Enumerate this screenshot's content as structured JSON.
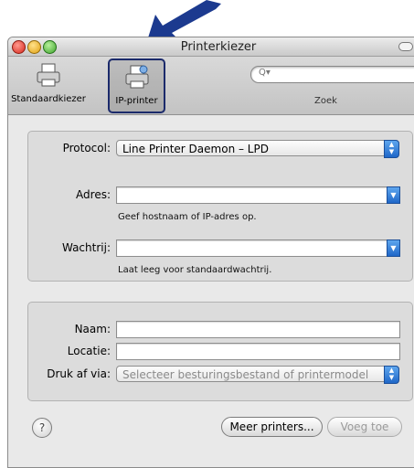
{
  "window": {
    "title": "Printerkiezer"
  },
  "toolbar": {
    "items": [
      {
        "label": "Standaardkiezer"
      },
      {
        "label": "IP-printer"
      }
    ],
    "search_label": "Zoek",
    "search_prefix": "Q"
  },
  "ip_panel": {
    "protocol_label": "Protocol:",
    "protocol_value": "Line Printer Daemon – LPD",
    "address_label": "Adres:",
    "address_value": "",
    "address_hint": "Geef hostnaam of IP-adres op.",
    "queue_label": "Wachtrij:",
    "queue_value": "",
    "queue_hint": "Laat leeg voor standaardwachtrij."
  },
  "printer_panel": {
    "name_label": "Naam:",
    "name_value": "",
    "location_label": "Locatie:",
    "location_value": "",
    "print_via_label": "Druk af via:",
    "print_via_value": "Selecteer besturingsbestand of printermodel"
  },
  "footer": {
    "help_glyph": "?",
    "more_printers": "Meer printers...",
    "add": "Voeg toe"
  },
  "colors": {
    "selection_outline": "#1b2a6b",
    "arrow": "#1c3a8f",
    "popup_accent": "#2f7ad8"
  }
}
